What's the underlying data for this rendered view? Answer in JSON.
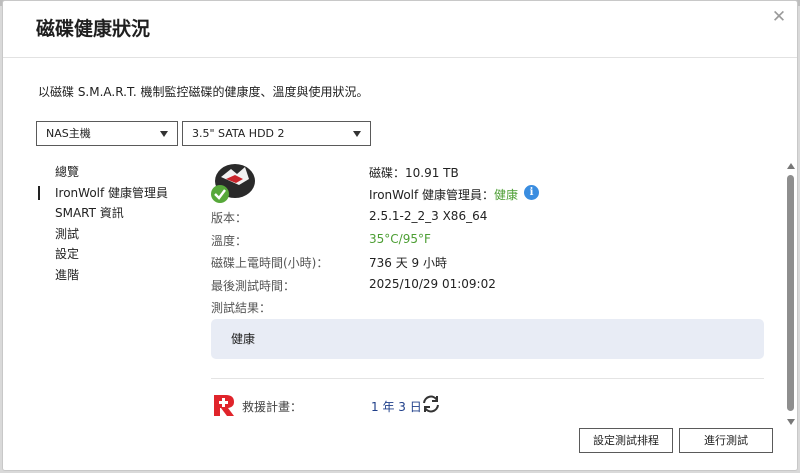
{
  "dialog": {
    "title": "磁碟健康狀況",
    "close_glyph": "✕",
    "description": "以磁碟 S.M.A.R.T. 機制監控磁碟的健康度、溫度與使用狀況。"
  },
  "selectors": {
    "nas": {
      "value": "NAS主機"
    },
    "disk": {
      "value": "3.5\" SATA HDD 2"
    }
  },
  "nav": {
    "items": [
      {
        "label": "總覽"
      },
      {
        "label": "IronWolf 健康管理員"
      },
      {
        "label": "SMART 資訊"
      },
      {
        "label": "測試"
      },
      {
        "label": "設定"
      },
      {
        "label": "進階"
      }
    ]
  },
  "details": {
    "disk_line": "磁碟：10.91 TB",
    "health_mgr_label": "IronWolf 健康管理員：",
    "health_mgr_value": "健康",
    "version_label": "版本：",
    "version_value": "2.5.1-2_2_3 X86_64",
    "temp_label": "溫度：",
    "temp_value": "35°C/95°F",
    "power_on_label": "磁碟上電時間(小時)：",
    "power_on_value": "736 天 9 小時",
    "last_test_label": "最後測試時間：",
    "last_test_value": "2025/10/29 01:09:02",
    "result_label": "測試結果：",
    "result_value": "健康"
  },
  "rescue": {
    "label": "救援計畫：",
    "value": "1 年 3 日"
  },
  "buttons": {
    "schedule": "設定測試排程",
    "run": "進行測試"
  },
  "colors": {
    "healthy_green": "#4c9e33",
    "info_blue": "#3a8de0",
    "rescue_red": "#e0242b",
    "result_box_bg": "#e8ecf5"
  },
  "icons": {
    "info": "i"
  }
}
